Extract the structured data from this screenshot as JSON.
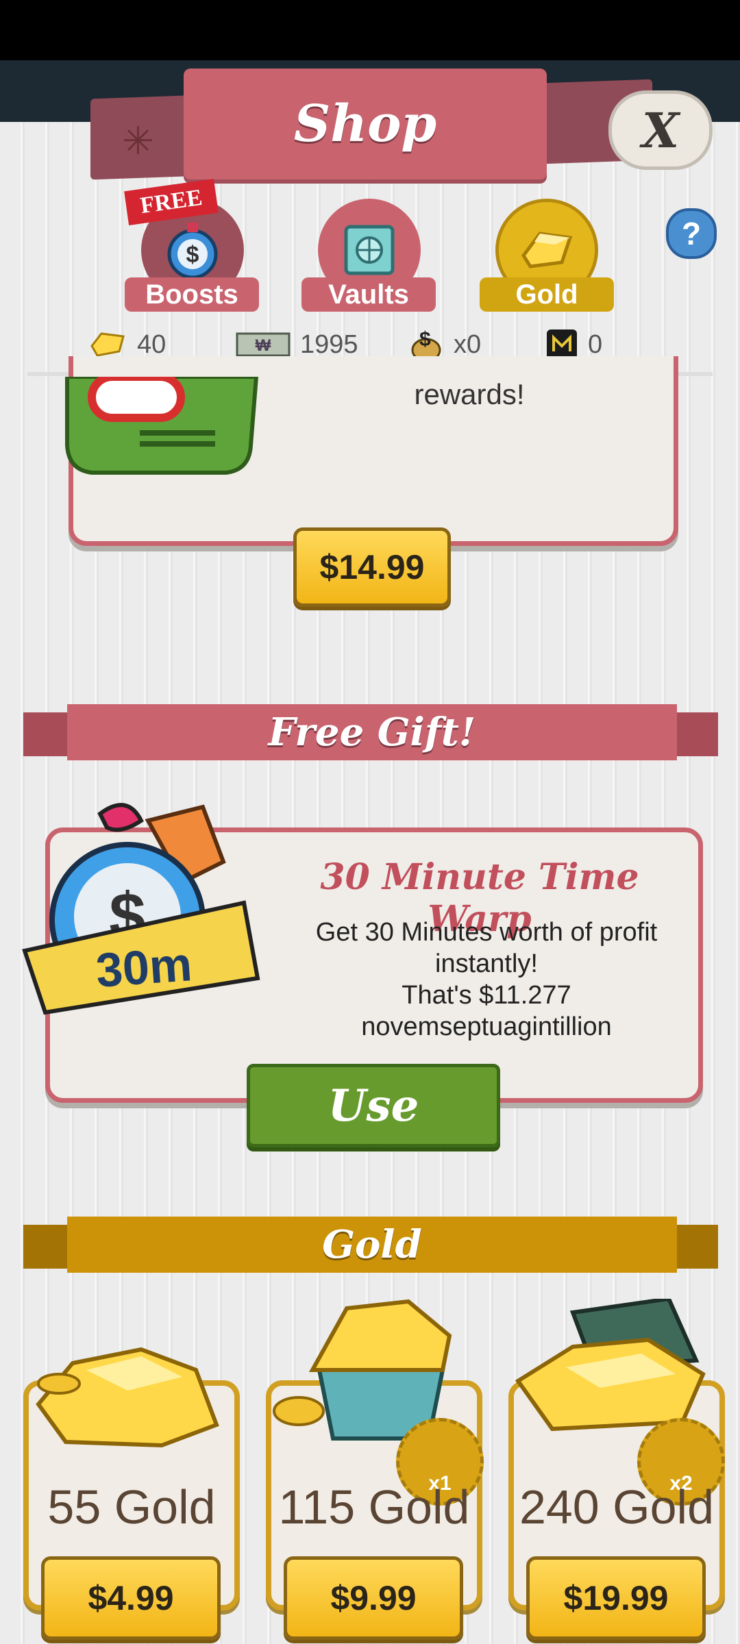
{
  "header": {
    "title": "Shop",
    "close_label": "X"
  },
  "tabs": [
    {
      "label": "Boosts",
      "badge": "FREE",
      "color": "#c9646f",
      "icon": "stopwatch-money-icon"
    },
    {
      "label": "Vaults",
      "color": "#c9646f",
      "icon": "vault-icon"
    },
    {
      "label": "Gold",
      "color": "#d1a412",
      "icon": "gold-bar-icon",
      "active": true
    }
  ],
  "help_label": "?",
  "currencies": [
    {
      "icon": "gold-gem-icon",
      "value": "40"
    },
    {
      "icon": "megabucks-icon",
      "value": "1995"
    },
    {
      "icon": "money-bag-icon",
      "value": "x0"
    },
    {
      "icon": "megaticket-icon",
      "value": "0"
    }
  ],
  "top_card": {
    "text": "rewards!",
    "price": "$14.99"
  },
  "free_gift": {
    "banner": "Free Gift!",
    "badge": "30m",
    "title": "30 Minute Time Warp",
    "line1": "Get 30 Minutes worth of profit",
    "line2": "instantly!",
    "line3": "That's $11.277 novemseptuagintillion",
    "button": "Use"
  },
  "gold_section": {
    "banner": "Gold",
    "items": [
      {
        "label": "55 Gold",
        "price": "$4.99"
      },
      {
        "label": "115 Gold",
        "price": "$9.99",
        "bonus": "x1"
      },
      {
        "label": "240 Gold",
        "price": "$19.99",
        "bonus": "x2"
      }
    ]
  },
  "colors": {
    "accent_pink": "#c9646f",
    "gold": "#d1a412",
    "green": "#679b2e"
  }
}
